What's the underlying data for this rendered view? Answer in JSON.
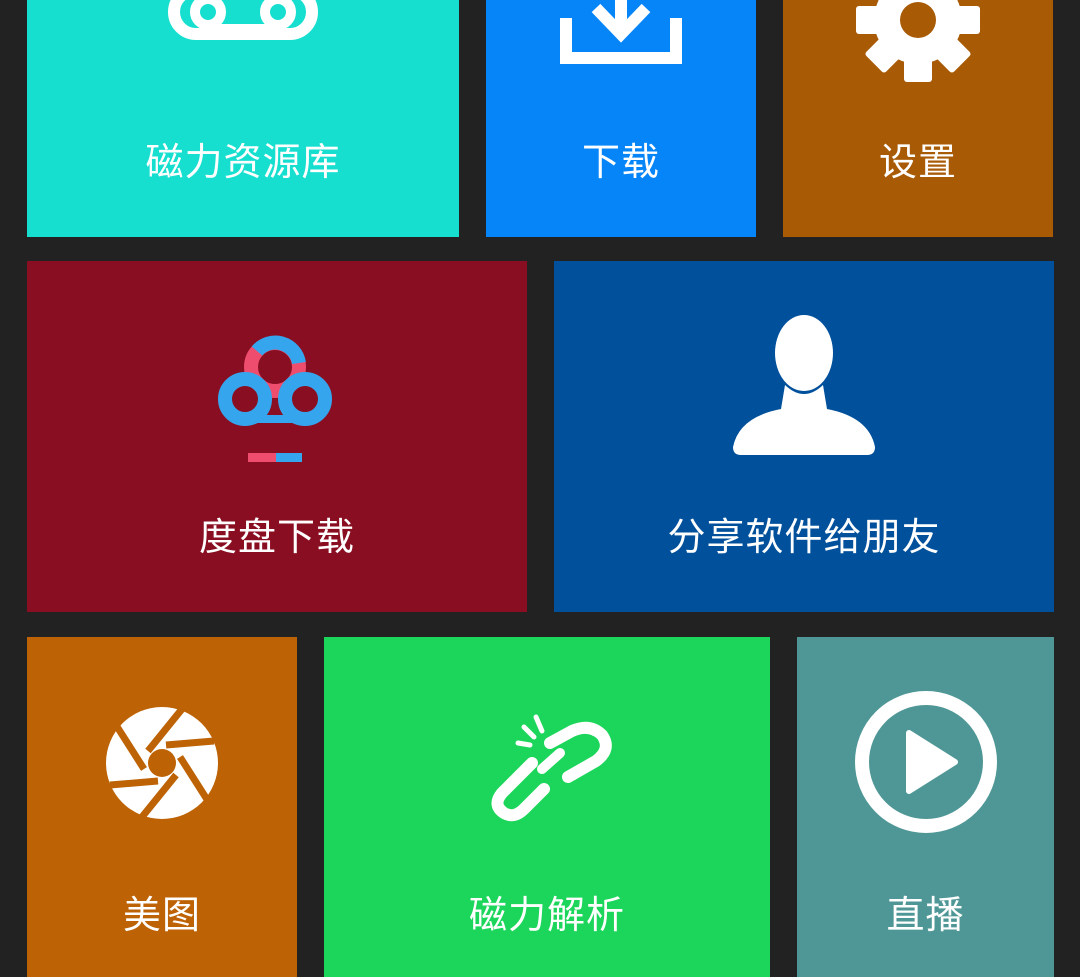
{
  "tiles": {
    "magnet_library": {
      "label": "磁力资源库",
      "color": "#17dfd0",
      "icon": "cassette-icon"
    },
    "download": {
      "label": "下载",
      "color": "#0585f7",
      "icon": "download-icon"
    },
    "settings": {
      "label": "设置",
      "color": "#a95a05",
      "icon": "gear-icon"
    },
    "baidu_download": {
      "label": "度盘下载",
      "color": "#8a0e21",
      "icon": "baidu-cloud-icon"
    },
    "share": {
      "label": "分享软件给朋友",
      "color": "#01509c",
      "icon": "user-silhouette-icon"
    },
    "meitu": {
      "label": "美图",
      "color": "#bd6205",
      "icon": "aperture-icon"
    },
    "magnet_parse": {
      "label": "磁力解析",
      "color": "#1bd65a",
      "icon": "broken-link-icon"
    },
    "live": {
      "label": "直播",
      "color": "#4f9796",
      "icon": "play-circle-icon"
    }
  }
}
